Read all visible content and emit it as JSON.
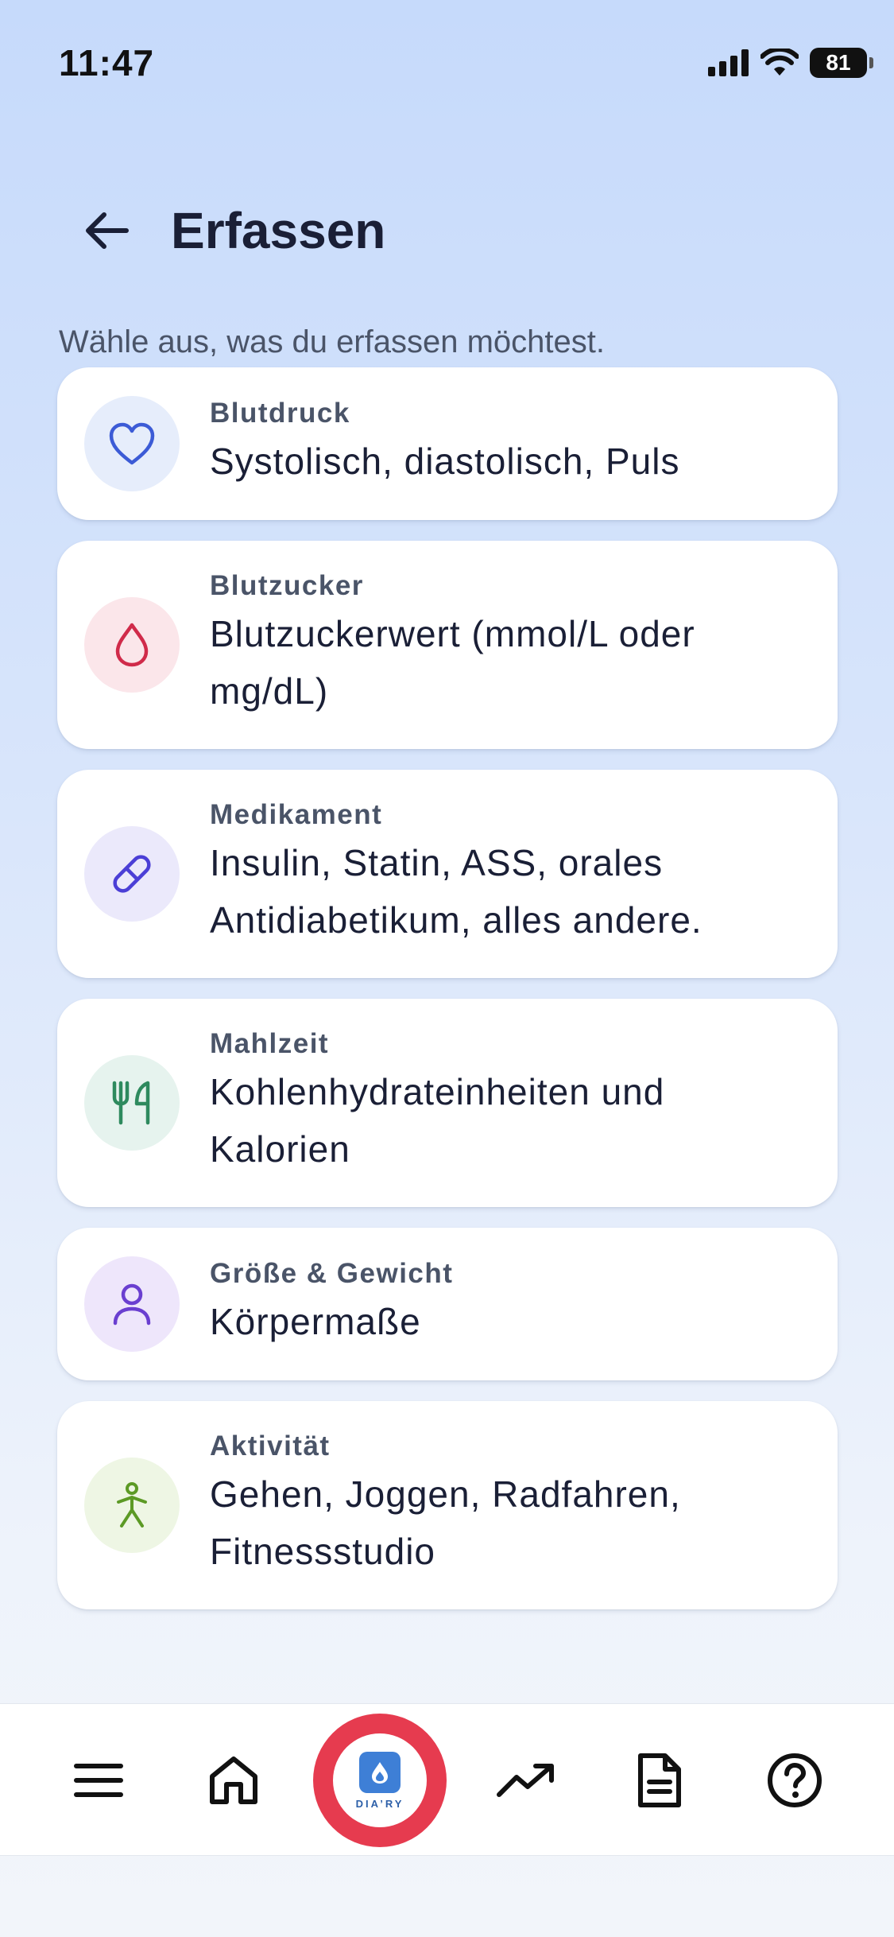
{
  "status_bar": {
    "time": "11:47",
    "battery": "81"
  },
  "header": {
    "title": "Erfassen",
    "subtitle": "Wähle aus, was du erfassen möchtest."
  },
  "cards": [
    {
      "title": "Blutdruck",
      "desc": "Systolisch, diastolisch, Puls",
      "icon": "heart-icon",
      "icon_bg": "#e6edfb",
      "icon_color": "#3c5bd6"
    },
    {
      "title": "Blutzucker",
      "desc": "Blutzuckerwert (mmol/L oder mg/dL)",
      "icon": "drop-icon",
      "icon_bg": "#fbe6ea",
      "icon_color": "#d02b4a"
    },
    {
      "title": "Medikament",
      "desc": "Insulin, Statin, ASS, orales Antidiabetikum, alles andere.",
      "icon": "pill-icon",
      "icon_bg": "#ebe9fb",
      "icon_color": "#4b3fd6"
    },
    {
      "title": "Mahlzeit",
      "desc": "Kohlenhydrateinheiten und Kalorien",
      "icon": "fork-knife-icon",
      "icon_bg": "#e6f3ee",
      "icon_color": "#2e8a5e"
    },
    {
      "title": "Größe & Gewicht",
      "desc": "Körpermaße",
      "icon": "person-icon",
      "icon_bg": "#eee6fb",
      "icon_color": "#6a3fd0"
    },
    {
      "title": "Aktivität",
      "desc": "Gehen, Joggen, Radfahren, Fitnessstudio",
      "icon": "walking-icon",
      "icon_bg": "#eef6e4",
      "icon_color": "#5c9a25"
    }
  ],
  "bottom_nav": {
    "items": [
      "menu-icon",
      "home-icon",
      "diary-logo",
      "trend-icon",
      "document-icon",
      "help-icon"
    ],
    "logo_text": "DIA’RY",
    "accent": "#e63b4f"
  }
}
